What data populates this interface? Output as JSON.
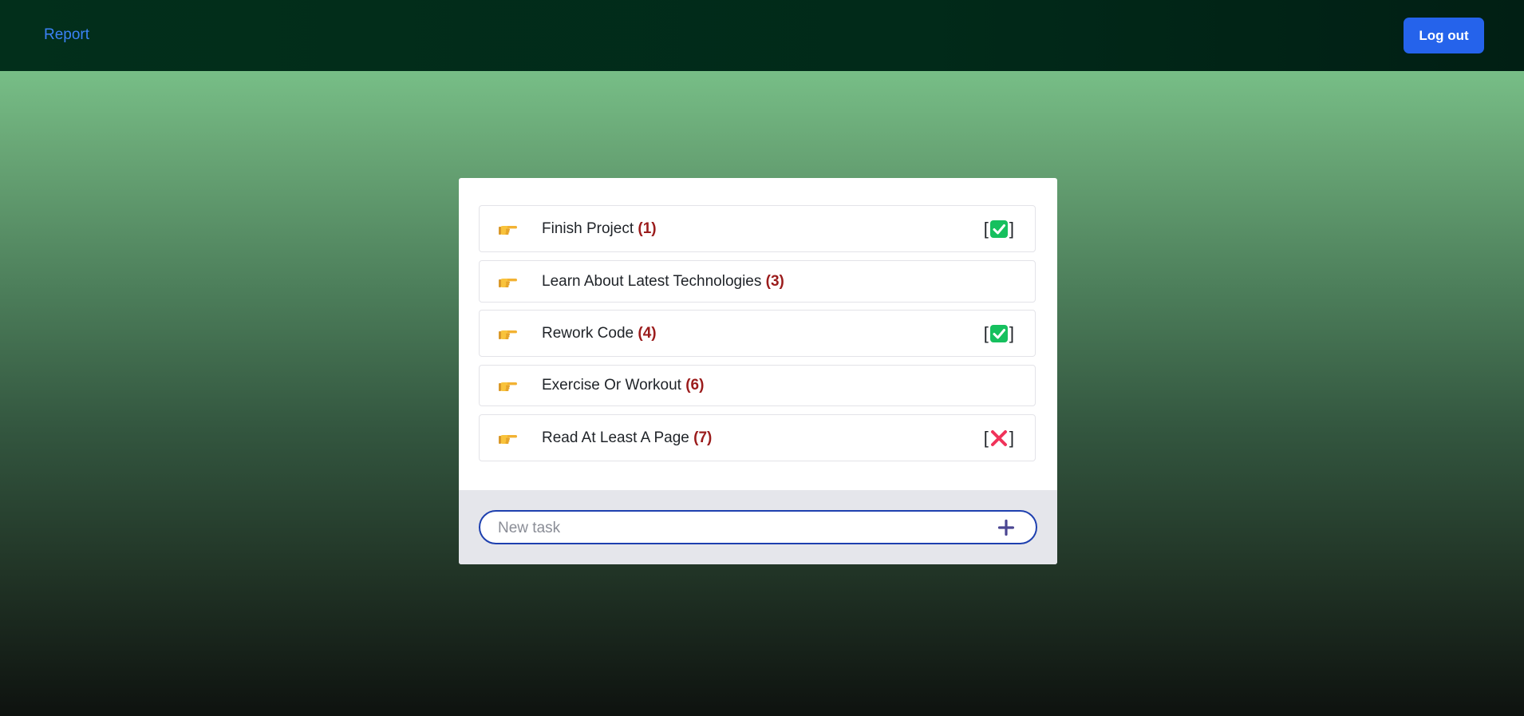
{
  "nav": {
    "report_label": "Report",
    "logout_label": "Log out"
  },
  "colors": {
    "nav_bg": "#022f1b",
    "link": "#3b82f6",
    "button": "#2563eb",
    "count": "#9b1c1c",
    "check_green": "#16c05e",
    "cross_red": "#f0335a",
    "input_border": "#1e40af",
    "plus": "#4b4692"
  },
  "tasks": [
    {
      "title": "Finish Project",
      "count": "(1)",
      "status": "done",
      "status_icon": "check-box-icon",
      "bracket_open": "[",
      "bracket_close": "]"
    },
    {
      "title": "Learn About Latest Technologies",
      "count": "(3)",
      "status": "none"
    },
    {
      "title": "Rework Code",
      "count": "(4)",
      "status": "done",
      "status_icon": "check-box-icon",
      "bracket_open": "[",
      "bracket_close": "]"
    },
    {
      "title": "Exercise Or Workout",
      "count": "(6)",
      "status": "none"
    },
    {
      "title": "Read At Least A Page",
      "count": "(7)",
      "status": "failed",
      "status_icon": "cross-mark-icon",
      "bracket_open": "[",
      "bracket_close": "]"
    }
  ],
  "new_task": {
    "placeholder": "New task",
    "value": "",
    "add_icon": "plus-icon"
  },
  "task_icon": "pointing-hand-icon"
}
